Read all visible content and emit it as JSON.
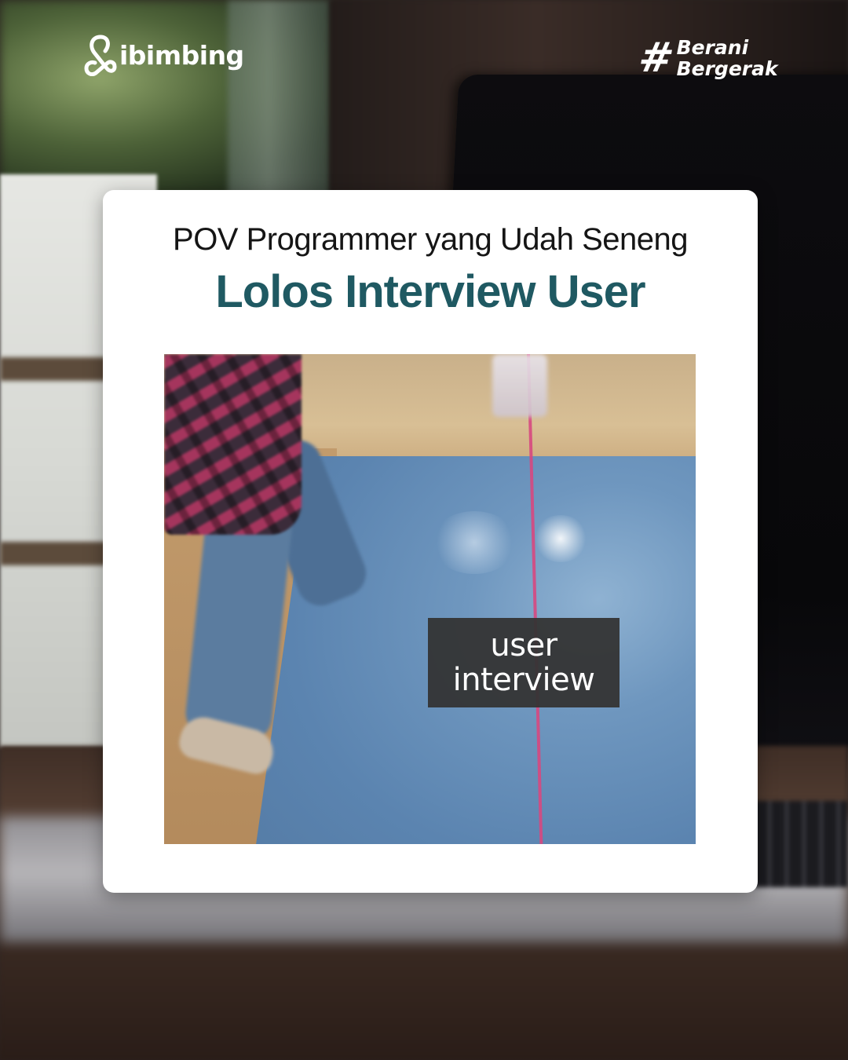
{
  "brand": {
    "logo_text": "ibimbing",
    "hashtag_symbol": "#",
    "hashtag_line1": "Berani",
    "hashtag_line2": "Bergerak"
  },
  "card": {
    "subtitle": "POV Programmer yang Udah Seneng",
    "title": "Lolos Interview User",
    "title_color": "#1f5962"
  },
  "video": {
    "caption_line1": "user",
    "caption_line2": "interview"
  }
}
